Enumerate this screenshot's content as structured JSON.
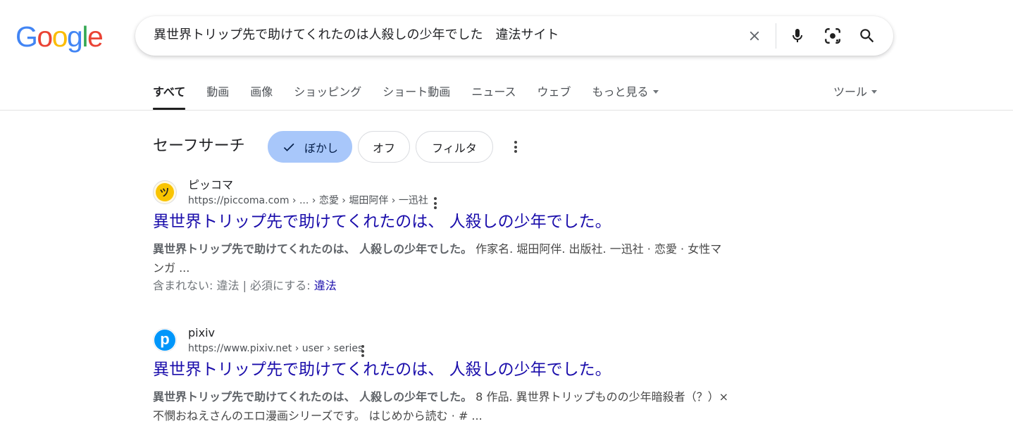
{
  "logo": {
    "letters": [
      "G",
      "o",
      "o",
      "g",
      "l",
      "e"
    ],
    "colors": [
      "#4285F4",
      "#EA4335",
      "#FBBC05",
      "#4285F4",
      "#34A853",
      "#EA4335"
    ]
  },
  "search": {
    "query": "異世界トリップ先で助けてくれたのは人殺しの少年でした　違法サイト"
  },
  "tabs": [
    {
      "label": "すべて",
      "active": true
    },
    {
      "label": "動画"
    },
    {
      "label": "画像"
    },
    {
      "label": "ショッピング"
    },
    {
      "label": "ショート動画"
    },
    {
      "label": "ニュース"
    },
    {
      "label": "ウェブ"
    },
    {
      "label": "もっと見る",
      "has_caret": true
    }
  ],
  "tools_label": "ツール",
  "safe_search": {
    "label": "セーフサーチ",
    "chips": {
      "blur": "ぼかし",
      "off": "オフ",
      "filter": "フィルタ"
    },
    "selected_color": "#a8c7fa"
  },
  "results": [
    {
      "site_name": "ピッコマ",
      "url": "https://piccoma.com › ... › 恋愛 › 堀田阿伴 › 一迅社",
      "title": "異世界トリップ先で助けてくれたのは、 人殺しの少年でした。",
      "snippet_bold": "異世界トリップ先で助けてくれたのは、 人殺しの少年でした。",
      "snippet_rest": " 作家名. 堀田阿伴. 出版社. 一迅社 · 恋愛 · 女性マンガ ...",
      "missing_label": "含まれない: 違法 | 必須にする: ",
      "missing_link": "違法",
      "favicon": "piccoma-icon",
      "favicon_glyph": "ツ"
    },
    {
      "site_name": "pixiv",
      "url": "https://www.pixiv.net › user › series",
      "title": "異世界トリップ先で助けてくれたのは、 人殺しの少年でした。",
      "snippet_bold": "異世界トリップ先で助けてくれたのは、 人殺しの少年でした。",
      "snippet_rest": " 8 作品. 異世界トリップものの少年暗殺者（？）×不憫おねえさんのエロ漫画シリーズです。 はじめから読む · # ...",
      "favicon": "pixiv-icon",
      "favicon_glyph": "p"
    }
  ],
  "colors": {
    "link": "#1a0dab",
    "text": "#202124",
    "secondary": "#4d5156"
  }
}
